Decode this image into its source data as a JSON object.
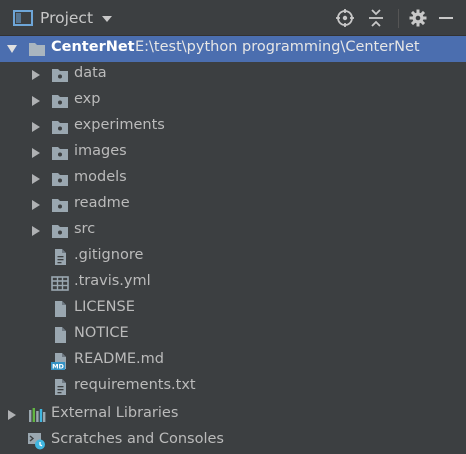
{
  "header": {
    "title": "Project",
    "icons": [
      "project-panel-icon",
      "dropdown-caret-icon",
      "locate-icon",
      "collapse-all-icon",
      "gear-icon",
      "minimize-icon"
    ]
  },
  "tree": {
    "root": {
      "name": "CenterNet",
      "path": "E:\\test\\python programming\\CenterNet",
      "icon": "folder-icon",
      "expanded": true,
      "selected": true
    },
    "folders": [
      {
        "name": "data"
      },
      {
        "name": "exp"
      },
      {
        "name": "experiments"
      },
      {
        "name": "images"
      },
      {
        "name": "models"
      },
      {
        "name": "readme"
      },
      {
        "name": "src"
      }
    ],
    "files": [
      {
        "name": ".gitignore",
        "icon": "text-file-icon"
      },
      {
        "name": ".travis.yml",
        "icon": "yaml-file-icon"
      },
      {
        "name": "LICENSE",
        "icon": "plain-file-icon"
      },
      {
        "name": "NOTICE",
        "icon": "plain-file-icon"
      },
      {
        "name": "README.md",
        "icon": "markdown-file-icon"
      },
      {
        "name": "requirements.txt",
        "icon": "text-file-icon"
      }
    ],
    "external_libraries": "External Libraries",
    "scratches": "Scratches and Consoles"
  },
  "colors": {
    "background": "#3c3f41",
    "selection": "#4b6eaf",
    "folder": "#9aa7b0",
    "text": "#bbbbbb",
    "md_badge": "#3592c4"
  }
}
